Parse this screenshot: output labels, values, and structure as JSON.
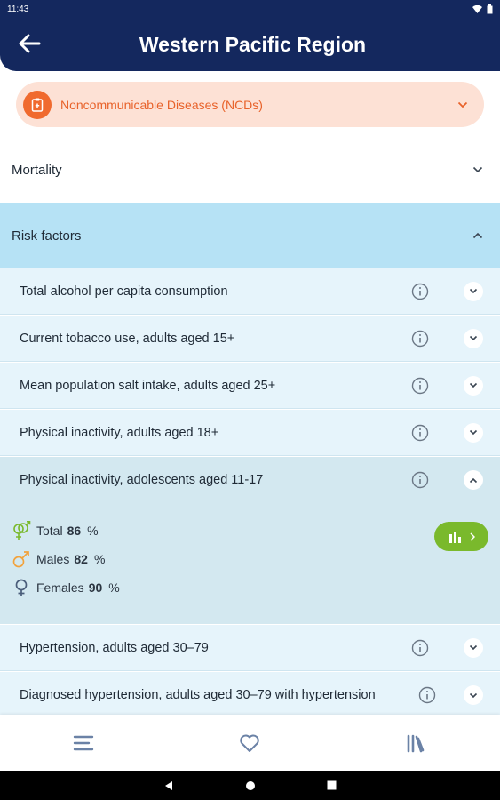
{
  "status_bar": {
    "time": "11:43"
  },
  "header": {
    "title": "Western Pacific Region",
    "back_icon": "arrow-left-icon"
  },
  "category": {
    "label": "Noncommunicable Diseases (NCDs)",
    "accent": "#f06a2e",
    "text_color": "#e8622a",
    "background": "#fde1d5"
  },
  "sections": {
    "mortality": {
      "label": "Mortality",
      "expanded": false
    },
    "risk_factors": {
      "label": "Risk factors",
      "expanded": true,
      "background": "#b6e2f5"
    }
  },
  "risk_items": [
    {
      "label": "Total alcohol per capita consumption",
      "expanded": false
    },
    {
      "label": "Current tobacco use, adults aged 15+",
      "expanded": false
    },
    {
      "label": "Mean population salt intake, adults aged 25+",
      "expanded": false
    },
    {
      "label": "Physical inactivity, adults aged 18+",
      "expanded": false
    },
    {
      "label": "Physical inactivity, adolescents aged 11-17",
      "expanded": true
    },
    {
      "label": "Hypertension, adults aged 30–79",
      "expanded": false
    },
    {
      "label": "Diagnosed hypertension, adults aged 30–79 with hypertension",
      "expanded": false
    }
  ],
  "expanded_detail": {
    "total": {
      "label": "Total",
      "value": "86",
      "unit": "%",
      "color": "#7ab92c"
    },
    "males": {
      "label": "Males",
      "value": "82",
      "unit": "%",
      "color": "#f2a23b"
    },
    "females": {
      "label": "Females",
      "value": "90",
      "unit": "%",
      "color": "#4a5d7a"
    },
    "chart_button_color": "#7ab92c"
  },
  "bottom_nav": [
    "menu-icon",
    "favorites-heart-icon",
    "library-icon"
  ]
}
